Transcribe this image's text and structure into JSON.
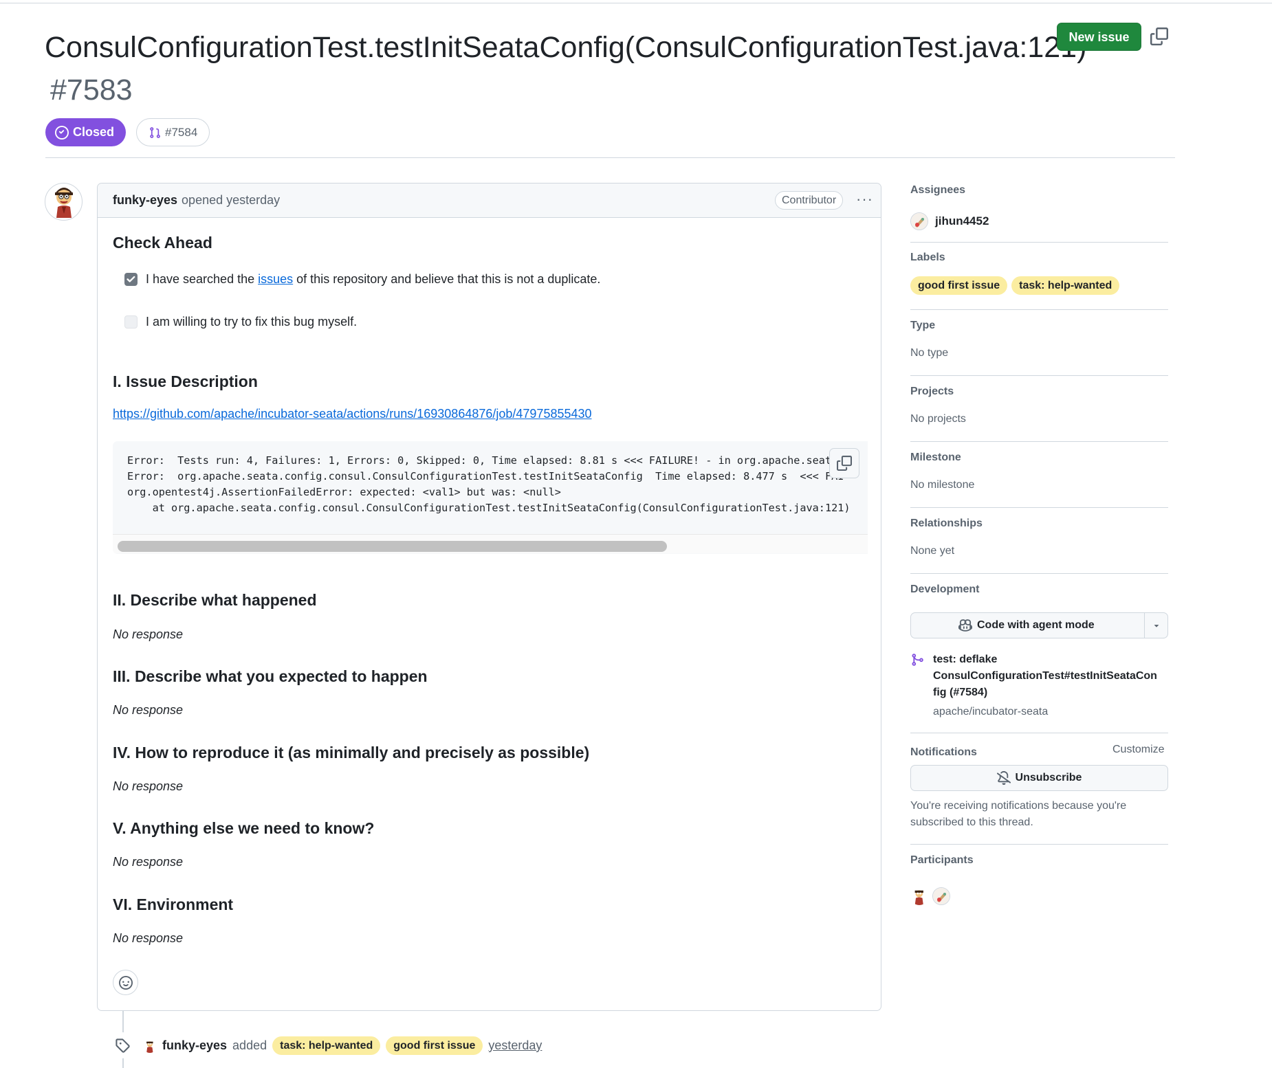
{
  "issue": {
    "title": "ConsulConfigurationTest.testInitSeataConfig(ConsulConfigurationTest.java:121)",
    "number": "#7583",
    "state": "Closed",
    "linked_pr": "#7584",
    "new_issue_label": "New issue"
  },
  "comment": {
    "author": "funky-eyes",
    "action": "opened yesterday",
    "role_badge": "Contributor",
    "check_ahead_heading": "Check Ahead",
    "checkbox1_before": "I have searched the",
    "checkbox1_link": "issues",
    "checkbox1_after": "of this repository and believe that this is not a duplicate.",
    "checkbox1_checked": true,
    "checkbox2": "I am willing to try to fix this bug myself.",
    "checkbox2_checked": false,
    "section1_heading": "I. Issue Description",
    "section1_url": "https://github.com/apache/incubator-seata/actions/runs/16930864876/job/47975855430",
    "code_lines": "Error:  Tests run: 4, Failures: 1, Errors: 0, Skipped: 0, Time elapsed: 8.81 s <<< FAILURE! - in org.apache.seata\nError:  org.apache.seata.config.consul.ConsulConfigurationTest.testInitSeataConfig  Time elapsed: 8.477 s  <<< FAI\norg.opentest4j.AssertionFailedError: expected: <val1> but was: <null>\n    at org.apache.seata.config.consul.ConsulConfigurationTest.testInitSeataConfig(ConsulConfigurationTest.java:121)",
    "section2_heading": "II. Describe what happened",
    "section3_heading": "III. Describe what you expected to happen",
    "section4_heading": "IV. How to reproduce it (as minimally and precisely as possible)",
    "section5_heading": "V. Anything else we need to know?",
    "section6_heading": "VI. Environment",
    "no_response": "No response"
  },
  "timeline": {
    "author": "funky-eyes",
    "action": "added",
    "labels": [
      "task: help-wanted",
      "good first issue"
    ],
    "time": "yesterday"
  },
  "sidebar": {
    "assignees_heading": "Assignees",
    "assignee": "jihun4452",
    "labels_heading": "Labels",
    "labels": [
      "good first issue",
      "task: help-wanted"
    ],
    "type_heading": "Type",
    "type_value": "No type",
    "projects_heading": "Projects",
    "projects_value": "No projects",
    "milestone_heading": "Milestone",
    "milestone_value": "No milestone",
    "relationships_heading": "Relationships",
    "relationships_value": "None yet",
    "development_heading": "Development",
    "code_agent_button": "Code with agent mode",
    "dev_pr_line1": "test: deflake",
    "dev_pr_line2": "ConsulConfigurationTest#testInitSeataCon",
    "dev_pr_line3": "fig (#7584)",
    "dev_pr_repo": "apache/incubator-seata",
    "notifications_heading": "Notifications",
    "customize_label": "Customize",
    "unsubscribe_button": "Unsubscribe",
    "notif_line1": "You're receiving notifications because you're",
    "notif_line2": "subscribed to this thread.",
    "participants_heading": "Participants"
  },
  "colors": {
    "closed": "#8250df",
    "new_issue": "#1f883d",
    "label_bg": "#fbeda0",
    "link": "#0969da"
  }
}
